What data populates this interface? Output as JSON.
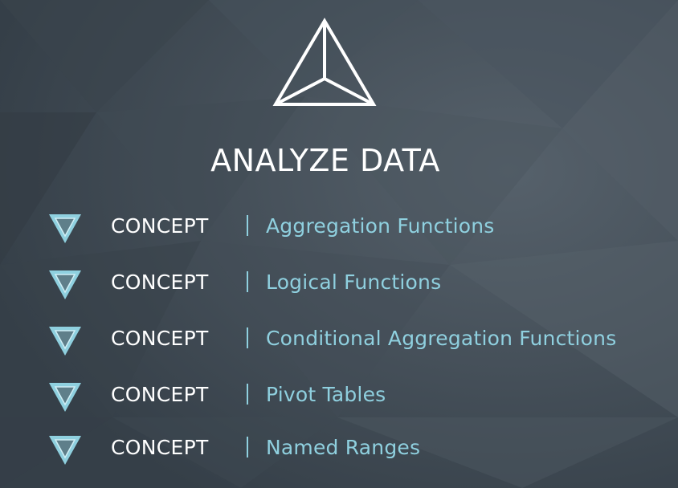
{
  "colors": {
    "background": "#3e4953",
    "accent": "#8fd0df",
    "text": "#ffffff"
  },
  "logo": {
    "icon": "pyramid-icon"
  },
  "title": "ANALYZE DATA",
  "items": [
    {
      "label": "CONCEPT",
      "topic": "Aggregation Functions"
    },
    {
      "label": "CONCEPT",
      "topic": "Logical Functions"
    },
    {
      "label": "CONCEPT",
      "topic": "Conditional Aggregation Functions"
    },
    {
      "label": "CONCEPT",
      "topic": "Pivot Tables"
    },
    {
      "label": "CONCEPT",
      "topic": "Named Ranges"
    }
  ]
}
